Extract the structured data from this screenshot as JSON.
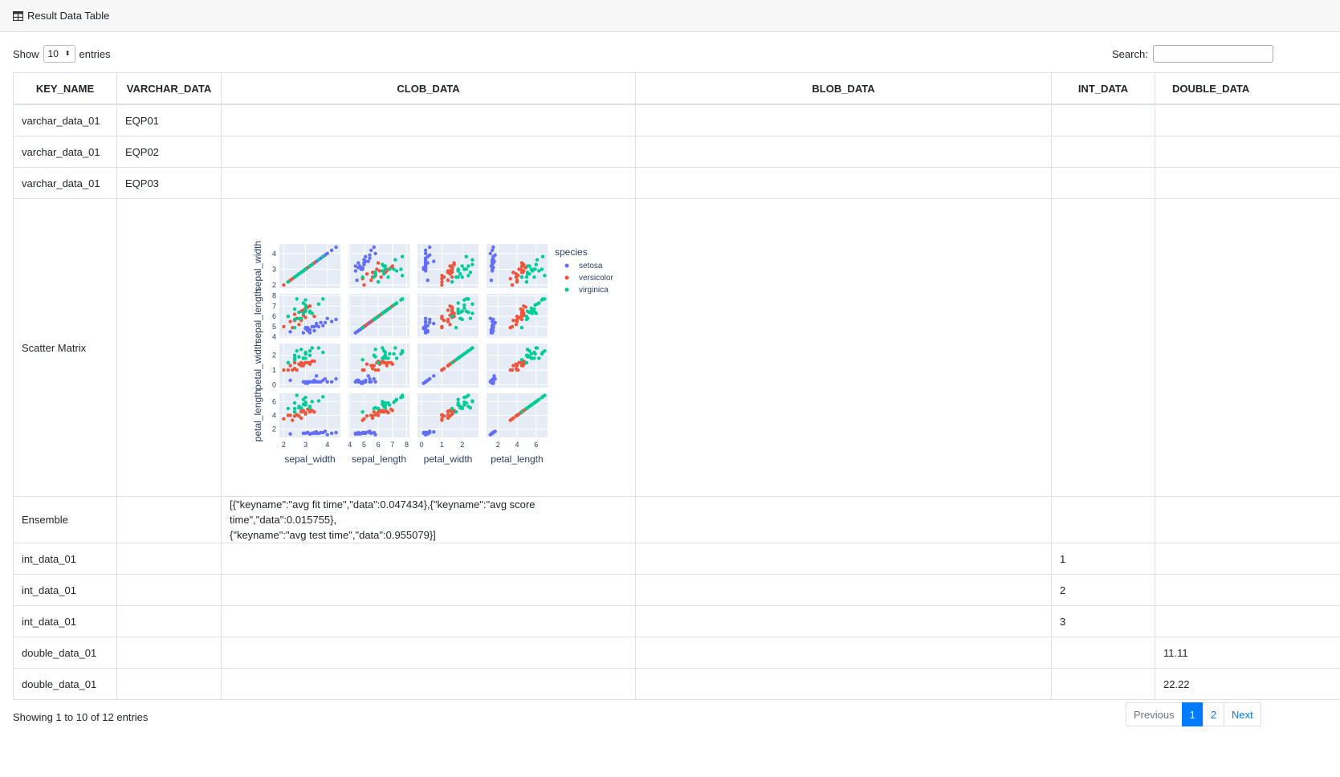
{
  "header": {
    "title": "Result Data Table"
  },
  "controls": {
    "show_label": "Show",
    "page_size": "10",
    "entries_label": "entries",
    "search_label": "Search:",
    "search_value": ""
  },
  "table": {
    "columns": [
      "KEY_NAME",
      "VARCHAR_DATA",
      "CLOB_DATA",
      "BLOB_DATA",
      "INT_DATA",
      "DOUBLE_DATA"
    ],
    "rows": [
      {
        "key": "varchar_data_01",
        "varchar": "EQP01",
        "clob": "",
        "blob": "",
        "int": "",
        "double": ""
      },
      {
        "key": "varchar_data_01",
        "varchar": "EQP02",
        "clob": "",
        "blob": "",
        "int": "",
        "double": ""
      },
      {
        "key": "varchar_data_01",
        "varchar": "EQP03",
        "clob": "",
        "blob": "",
        "int": "",
        "double": ""
      },
      {
        "key": "Scatter Matrix",
        "varchar": "",
        "clob": "",
        "blob": "",
        "int": "",
        "double": ""
      },
      {
        "key": "Ensemble",
        "varchar": "",
        "clob_line1": "[{\"keyname\":\"avg fit time\",\"data\":0.047434},{\"keyname\":\"avg score time\",\"data\":0.015755},",
        "clob_line2": "{\"keyname\":\"avg test time\",\"data\":0.955079}]",
        "blob": "",
        "int": "",
        "double": ""
      },
      {
        "key": "int_data_01",
        "varchar": "",
        "clob": "",
        "blob": "",
        "int": "1",
        "double": ""
      },
      {
        "key": "int_data_01",
        "varchar": "",
        "clob": "",
        "blob": "",
        "int": "2",
        "double": ""
      },
      {
        "key": "int_data_01",
        "varchar": "",
        "clob": "",
        "blob": "",
        "int": "3",
        "double": ""
      },
      {
        "key": "double_data_01",
        "varchar": "",
        "clob": "",
        "blob": "",
        "int": "",
        "double": "11.11"
      },
      {
        "key": "double_data_01",
        "varchar": "",
        "clob": "",
        "blob": "",
        "int": "",
        "double": "22.22"
      }
    ]
  },
  "footer": {
    "info": "Showing 1 to 10 of 12 entries"
  },
  "pagination": {
    "previous": "Previous",
    "page1": "1",
    "page2": "2",
    "next": "Next"
  },
  "chart_data": {
    "type": "scatter",
    "title": "",
    "dimensions": [
      "sepal_width",
      "sepal_length",
      "petal_width",
      "petal_length"
    ],
    "ticks": {
      "sepal_width": [
        "2",
        "3",
        "4"
      ],
      "sepal_length": [
        "4",
        "5",
        "6",
        "7",
        "8"
      ],
      "petal_width": [
        "0",
        "1",
        "2"
      ],
      "petal_length": [
        "2",
        "4",
        "6"
      ]
    },
    "ranges": {
      "sepal_width": [
        1.8,
        4.6
      ],
      "sepal_length": [
        3.9,
        8.2
      ],
      "petal_width": [
        -0.2,
        2.8
      ],
      "petal_length": [
        0.8,
        7.2
      ]
    },
    "legend": {
      "title": "species",
      "position": "right"
    },
    "series": [
      {
        "name": "setosa",
        "color": "#636efa",
        "sepal_width": [
          3.5,
          3.0,
          3.2,
          3.1,
          3.6,
          3.9,
          3.4,
          3.4,
          2.9,
          3.1,
          3.7,
          3.0,
          4.0,
          4.4,
          3.8,
          3.3,
          4.2,
          2.3,
          3.2,
          3.5
        ],
        "sepal_length": [
          5.1,
          4.9,
          4.7,
          4.6,
          5.0,
          5.4,
          4.6,
          5.0,
          4.4,
          4.9,
          5.4,
          4.8,
          5.8,
          5.7,
          5.1,
          5.0,
          5.5,
          4.5,
          4.4,
          5.3
        ],
        "petal_width": [
          0.2,
          0.2,
          0.2,
          0.2,
          0.2,
          0.4,
          0.3,
          0.2,
          0.2,
          0.1,
          0.2,
          0.1,
          0.2,
          0.4,
          0.3,
          0.2,
          0.2,
          0.3,
          0.2,
          0.6
        ],
        "petal_length": [
          1.4,
          1.4,
          1.3,
          1.5,
          1.4,
          1.7,
          1.4,
          1.5,
          1.4,
          1.5,
          1.5,
          1.4,
          1.2,
          1.5,
          1.5,
          1.4,
          1.4,
          1.3,
          1.3,
          1.6
        ]
      },
      {
        "name": "versicolor",
        "color": "#ef553b",
        "sepal_width": [
          3.2,
          3.2,
          3.1,
          2.3,
          2.8,
          2.8,
          3.3,
          2.4,
          2.9,
          2.7,
          2.0,
          3.0,
          2.2,
          2.9,
          2.5,
          3.0,
          2.6,
          2.5,
          2.8,
          3.4
        ],
        "sepal_length": [
          7.0,
          6.4,
          6.9,
          5.5,
          6.5,
          5.7,
          6.3,
          4.9,
          6.6,
          5.2,
          5.0,
          5.9,
          6.0,
          6.1,
          5.6,
          6.7,
          5.8,
          6.2,
          5.6,
          6.0
        ],
        "petal_width": [
          1.4,
          1.5,
          1.5,
          1.3,
          1.5,
          1.3,
          1.6,
          1.0,
          1.3,
          1.4,
          1.0,
          1.5,
          1.0,
          1.4,
          1.1,
          1.5,
          1.0,
          1.5,
          1.3,
          1.6
        ],
        "petal_length": [
          4.7,
          4.5,
          4.9,
          4.0,
          4.6,
          4.5,
          4.7,
          3.3,
          4.6,
          3.9,
          3.5,
          4.2,
          4.0,
          4.7,
          3.9,
          4.4,
          4.1,
          4.5,
          3.6,
          4.5
        ]
      },
      {
        "name": "virginica",
        "color": "#00cc96",
        "sepal_width": [
          3.3,
          2.7,
          3.0,
          2.9,
          3.0,
          3.0,
          2.5,
          2.9,
          2.5,
          3.6,
          3.2,
          2.7,
          3.0,
          2.5,
          2.8,
          3.2,
          3.0,
          3.8,
          2.6,
          2.2
        ],
        "sepal_length": [
          6.3,
          5.8,
          7.1,
          6.3,
          6.5,
          7.6,
          4.9,
          7.3,
          6.7,
          7.2,
          6.5,
          6.4,
          6.8,
          5.7,
          5.8,
          6.4,
          6.5,
          7.7,
          7.7,
          6.0
        ],
        "petal_width": [
          2.5,
          1.9,
          2.1,
          1.8,
          2.2,
          2.1,
          1.7,
          1.8,
          1.8,
          2.5,
          2.0,
          1.9,
          2.1,
          2.0,
          2.4,
          2.3,
          1.8,
          2.2,
          2.3,
          1.5
        ],
        "petal_length": [
          6.0,
          5.1,
          5.9,
          5.6,
          5.8,
          6.6,
          4.5,
          6.3,
          5.8,
          6.1,
          5.1,
          5.3,
          5.5,
          5.0,
          5.1,
          5.3,
          5.5,
          6.7,
          6.9,
          5.0
        ]
      }
    ]
  }
}
